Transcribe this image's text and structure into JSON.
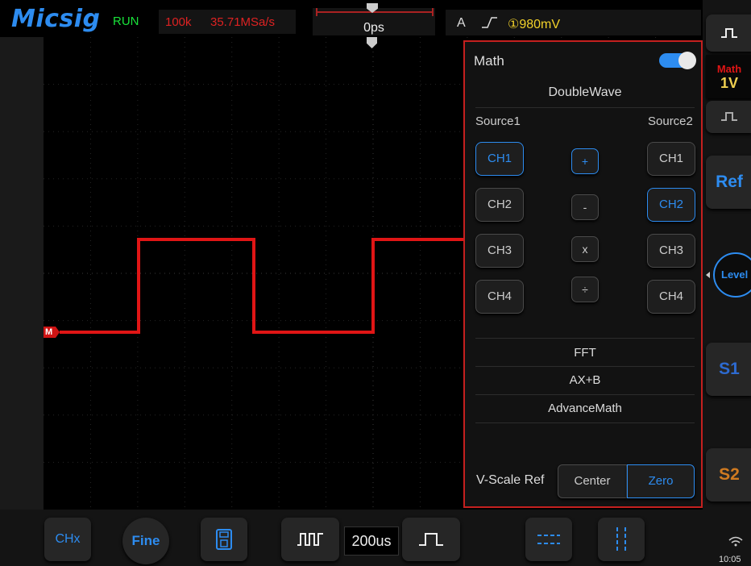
{
  "header": {
    "logo": "Micsig",
    "run_state": "RUN",
    "memory_depth": "100k",
    "sample_rate": "35.71MSa/s",
    "time_position": "0ps",
    "trigger": {
      "source": "A",
      "edge_glyph": "⎍",
      "level": "①980mV"
    }
  },
  "waveform": {
    "channel_marker": "M",
    "color": "#e01515"
  },
  "math_panel": {
    "title": "Math",
    "enabled": true,
    "mode": "DoubleWave",
    "source1_label": "Source1",
    "source2_label": "Source2",
    "source1": [
      "CH1",
      "CH2",
      "CH3",
      "CH4"
    ],
    "source1_selected": "CH1",
    "operators": [
      "+",
      "-",
      "x",
      "÷"
    ],
    "operator_selected": "+",
    "source2": [
      "CH1",
      "CH2",
      "CH3",
      "CH4"
    ],
    "source2_selected": "CH2",
    "functions": [
      "FFT",
      "AX+B",
      "AdvanceMath"
    ],
    "vscale_label": "V-Scale Ref",
    "vscale_options": [
      "Center",
      "Zero"
    ],
    "vscale_selected": "Zero"
  },
  "sidebar": {
    "top_icon": "pulse-icon",
    "math_label": "Math",
    "math_scale": "1V",
    "ref_label": "Ref",
    "level_label": "Level",
    "s1_label": "S1",
    "s2_label": "S2",
    "time_partial": "10:05"
  },
  "bottombar": {
    "chx_label": "CHx",
    "fine_label": "Fine",
    "timebase": "200us"
  },
  "colors": {
    "accent": "#2d8cf0",
    "math": "#e01515",
    "run": "#19e33a",
    "trigger_level": "#f2d12a",
    "panel_border": "#c4201f"
  }
}
